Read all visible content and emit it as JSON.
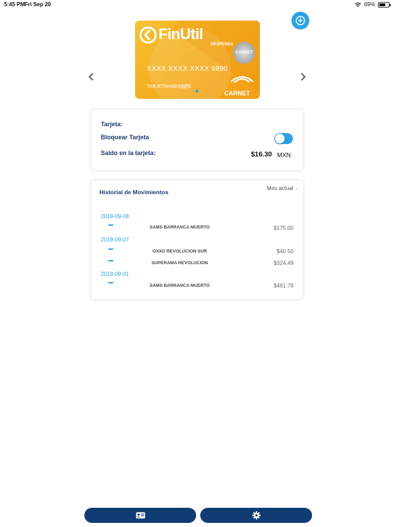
{
  "status_bar": {
    "time": "5:45 PM",
    "date": "Fri Sep 20",
    "battery": "69%",
    "battery_level": 0.69,
    "icons": [
      "wifi-icon",
      "battery-icon"
    ]
  },
  "header": {
    "add_icon": "plus-circle-icon",
    "prev_icon": "chevron-left-icon",
    "next_icon": "chevron-right-icon"
  },
  "card": {
    "brand": "FinUtil",
    "subbrand": "DESPENSA",
    "number": "XXXX XXXX XXXX 9890",
    "valid_label": "VALIDA HASTA",
    "holder": "TARJETAHABIENTE",
    "network": "CARNET",
    "seal": "CARNET",
    "colors": {
      "primary": "#f4ae1f",
      "accent": "#29a3e6"
    }
  },
  "info": {
    "card_label": "Tarjeta:",
    "block_label": "Bloquear Tarjeta",
    "block_enabled": true,
    "balance_label": "Saldo en la tarjeta:",
    "balance_amount": "$16.30",
    "balance_currency": "MXN"
  },
  "history": {
    "title": "Historial de Movimientos",
    "filter": "Mes actual",
    "groups": [
      {
        "date": "2019-09-08",
        "items": [
          {
            "name": "SAMS BARRANCA MUERTO",
            "amount": "$175.00"
          }
        ]
      },
      {
        "date": "2019-09-07",
        "items": [
          {
            "name": "OXXO REVOLUCION SUR",
            "amount": "$40.50"
          },
          {
            "name": "SUPERAMA REVOLUCION",
            "amount": "$324.49"
          }
        ]
      },
      {
        "date": "2019-09-01",
        "items": [
          {
            "name": "SAMS BARRANCA MUERTO",
            "amount": "$461.79"
          }
        ]
      }
    ]
  },
  "footer": {
    "cards_icon": "id-card-icon",
    "settings_icon": "gear-icon",
    "color": "#0e3c73"
  }
}
